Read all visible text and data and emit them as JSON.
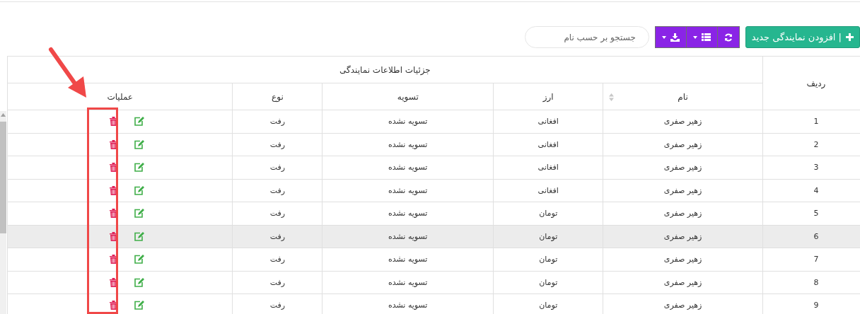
{
  "toolbar": {
    "add_button": {
      "label": "| افزودن نمایندگی جدید"
    },
    "tools": [
      {
        "kind": "refresh",
        "dropdown": false
      },
      {
        "kind": "columns",
        "dropdown": true
      },
      {
        "kind": "export",
        "dropdown": true
      }
    ],
    "search": {
      "placeholder": "جستجو بر حسب نام"
    }
  },
  "table": {
    "row_header": "ردیف",
    "group_header": "جزئیات اطلاعات نمایندگی",
    "columns": [
      {
        "label": "نام",
        "sortable": true
      },
      {
        "label": "ارز",
        "sortable": false
      },
      {
        "label": "تسویه",
        "sortable": false
      },
      {
        "label": "نوع",
        "sortable": false
      },
      {
        "label": "عملیات",
        "sortable": false
      }
    ],
    "rows": [
      {
        "index": "1",
        "name": "زهیر صفری",
        "currency": "افغانی",
        "settlement": "تسویه نشده",
        "type": "رفت",
        "highlighted": false
      },
      {
        "index": "2",
        "name": "زهیر صفری",
        "currency": "افغانی",
        "settlement": "تسویه نشده",
        "type": "رفت",
        "highlighted": false
      },
      {
        "index": "3",
        "name": "زهیر صفری",
        "currency": "افغانی",
        "settlement": "تسویه نشده",
        "type": "رفت",
        "highlighted": false
      },
      {
        "index": "4",
        "name": "زهیر صفری",
        "currency": "افغانی",
        "settlement": "تسویه نشده",
        "type": "رفت",
        "highlighted": false
      },
      {
        "index": "5",
        "name": "زهیر صفری",
        "currency": "تومان",
        "settlement": "تسویه نشده",
        "type": "رفت",
        "highlighted": false
      },
      {
        "index": "6",
        "name": "زهیر صفری",
        "currency": "تومان",
        "settlement": "تسویه نشده",
        "type": "رفت",
        "highlighted": true
      },
      {
        "index": "7",
        "name": "زهیر صفری",
        "currency": "تومان",
        "settlement": "تسویه نشده",
        "type": "رفت",
        "highlighted": false
      },
      {
        "index": "8",
        "name": "زهیر صفری",
        "currency": "تومان",
        "settlement": "تسویه نشده",
        "type": "رفت",
        "highlighted": false
      },
      {
        "index": "9",
        "name": "زهیر صفری",
        "currency": "تومان",
        "settlement": "تسویه نشده",
        "type": "رفت",
        "highlighted": false
      }
    ]
  }
}
